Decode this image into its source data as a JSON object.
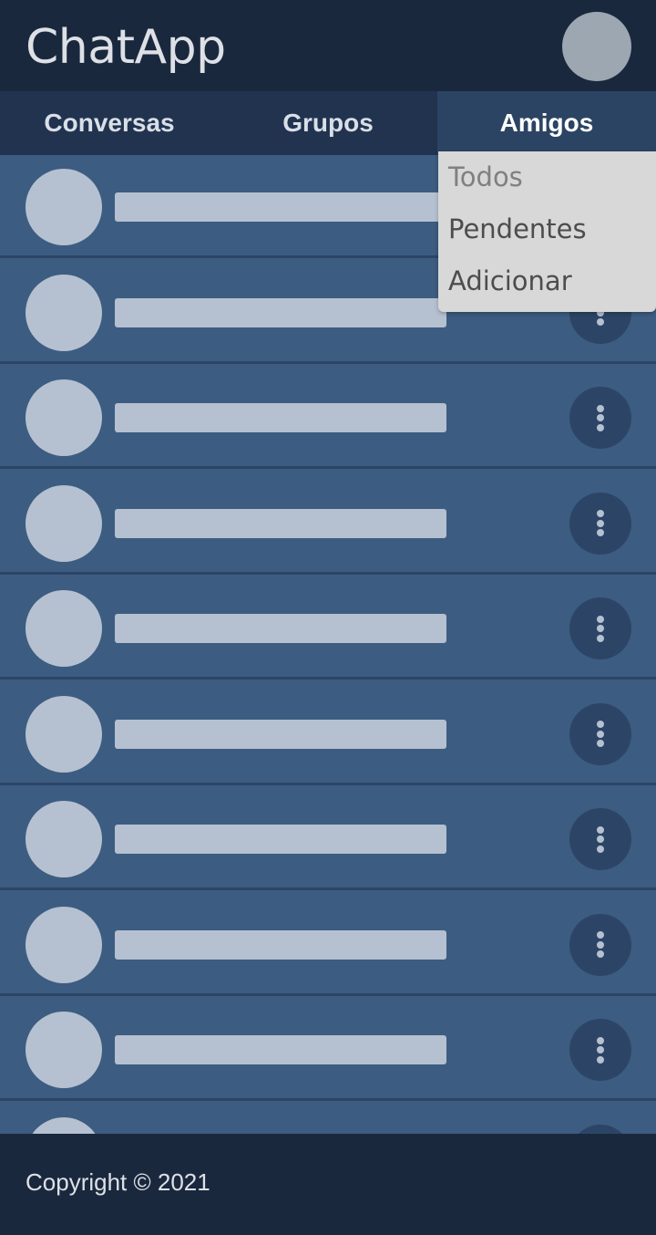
{
  "app": {
    "title": "ChatApp"
  },
  "tabs": [
    {
      "label": "Conversas",
      "active": false
    },
    {
      "label": "Grupos",
      "active": false
    },
    {
      "label": "Amigos",
      "active": true
    }
  ],
  "dropdown": {
    "items": [
      {
        "label": "Todos",
        "state": "muted"
      },
      {
        "label": "Pendentes",
        "state": "normal"
      },
      {
        "label": "Adicionar",
        "state": "normal"
      }
    ]
  },
  "friends_list": {
    "visible_rows": 10,
    "row_icon": "more-vertical-icon"
  },
  "footer": {
    "copyright": "Copyright © 2021"
  },
  "colors": {
    "header_bg": "#1a283e",
    "tab_bar_bg": "#21334f",
    "tab_active_bg": "#2c4463",
    "list_bg": "#3d5c81",
    "placeholder": "#b5c1d0",
    "dropdown_bg": "#d8d8d8"
  }
}
